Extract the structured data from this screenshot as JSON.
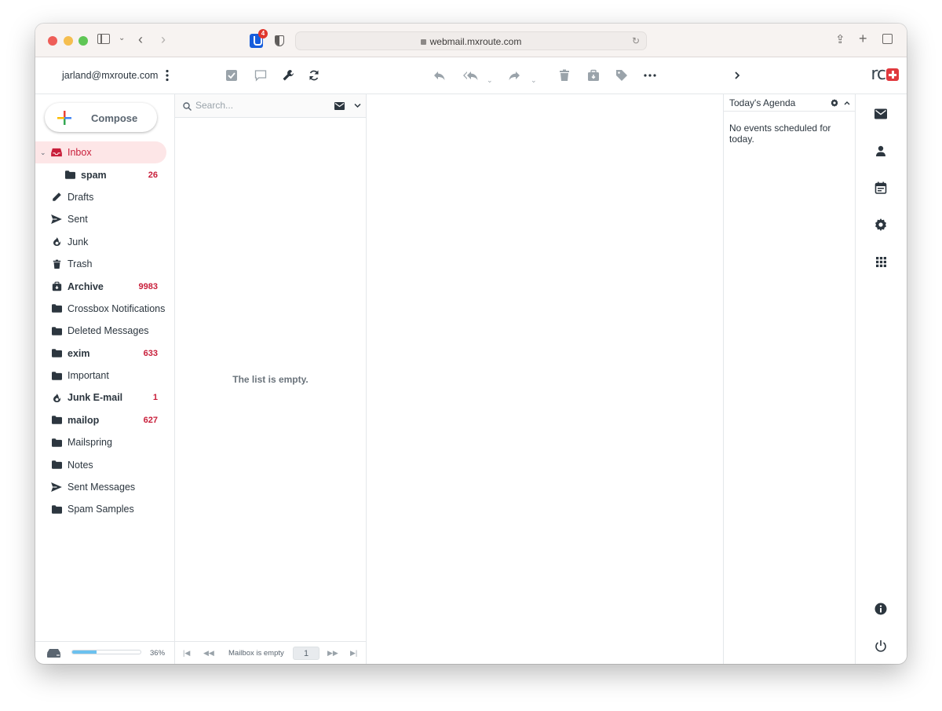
{
  "browser": {
    "url": "webmail.mxroute.com",
    "extension_badge": "4"
  },
  "header": {
    "user_email": "jarland@mxroute.com",
    "toolbar": {
      "select": "select-icon",
      "threads": "threads-icon",
      "options": "wrench-icon",
      "refresh": "refresh-icon",
      "reply": "reply-icon",
      "reply_all": "reply-all-icon",
      "forward": "forward-icon",
      "delete": "trash-icon",
      "archive": "archive-icon",
      "mark": "tag-icon",
      "more": "more-icon",
      "expand": "chevron-right-icon"
    }
  },
  "sidebar": {
    "compose_label": "Compose",
    "folders": [
      {
        "name": "Inbox",
        "icon": "inbox",
        "count": "",
        "active": true
      },
      {
        "name": "spam",
        "icon": "folder",
        "count": "26",
        "sub": true,
        "bold": true
      },
      {
        "name": "Drafts",
        "icon": "pencil",
        "count": ""
      },
      {
        "name": "Sent",
        "icon": "send",
        "count": ""
      },
      {
        "name": "Junk",
        "icon": "fire",
        "count": ""
      },
      {
        "name": "Trash",
        "icon": "trash",
        "count": ""
      },
      {
        "name": "Archive",
        "icon": "archive",
        "count": "9983",
        "bold": true
      },
      {
        "name": "Crossbox Notifications",
        "icon": "folder",
        "count": ""
      },
      {
        "name": "Deleted Messages",
        "icon": "folder",
        "count": ""
      },
      {
        "name": "exim",
        "icon": "folder",
        "count": "633",
        "bold": true
      },
      {
        "name": "Important",
        "icon": "folder",
        "count": ""
      },
      {
        "name": "Junk E-mail",
        "icon": "fire",
        "count": "1",
        "bold": true
      },
      {
        "name": "mailop",
        "icon": "folder",
        "count": "627",
        "bold": true
      },
      {
        "name": "Mailspring",
        "icon": "folder",
        "count": ""
      },
      {
        "name": "Notes",
        "icon": "folder",
        "count": ""
      },
      {
        "name": "Sent Messages",
        "icon": "send",
        "count": ""
      },
      {
        "name": "Spam Samples",
        "icon": "folder",
        "count": ""
      }
    ],
    "quota": {
      "percent": 36,
      "label": "36%"
    }
  },
  "message_list": {
    "search_placeholder": "Search...",
    "empty_text": "The list is empty.",
    "footer_status": "Mailbox is empty",
    "page": "1"
  },
  "agenda": {
    "title": "Today's Agenda",
    "empty_text": "No events scheduled for today."
  },
  "colors": {
    "accent": "#c81e3a",
    "active_bg": "#fde6e7",
    "quota": "#6bc1ef"
  }
}
